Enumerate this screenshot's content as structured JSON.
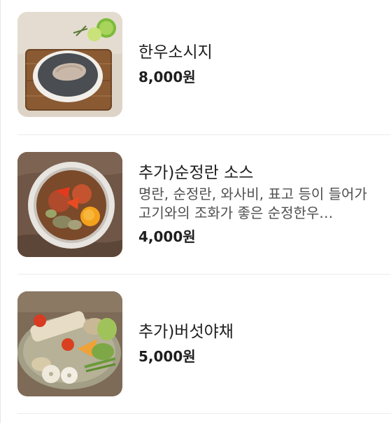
{
  "menu": {
    "items": [
      {
        "name": "한우소시지",
        "description": "",
        "price": "8,000원"
      },
      {
        "name": "추가)순정란 소스",
        "description": "명란, 순정란, 와사비, 표고 등이 들어가 고기와의 조화가 좋은 순정한우…",
        "price": "4,000원"
      },
      {
        "name": "추가)버섯야채",
        "description": "",
        "price": "5,000원"
      }
    ]
  },
  "colors": {
    "text_primary": "#1e1e1e",
    "text_secondary": "#505050",
    "divider": "#ececec"
  }
}
